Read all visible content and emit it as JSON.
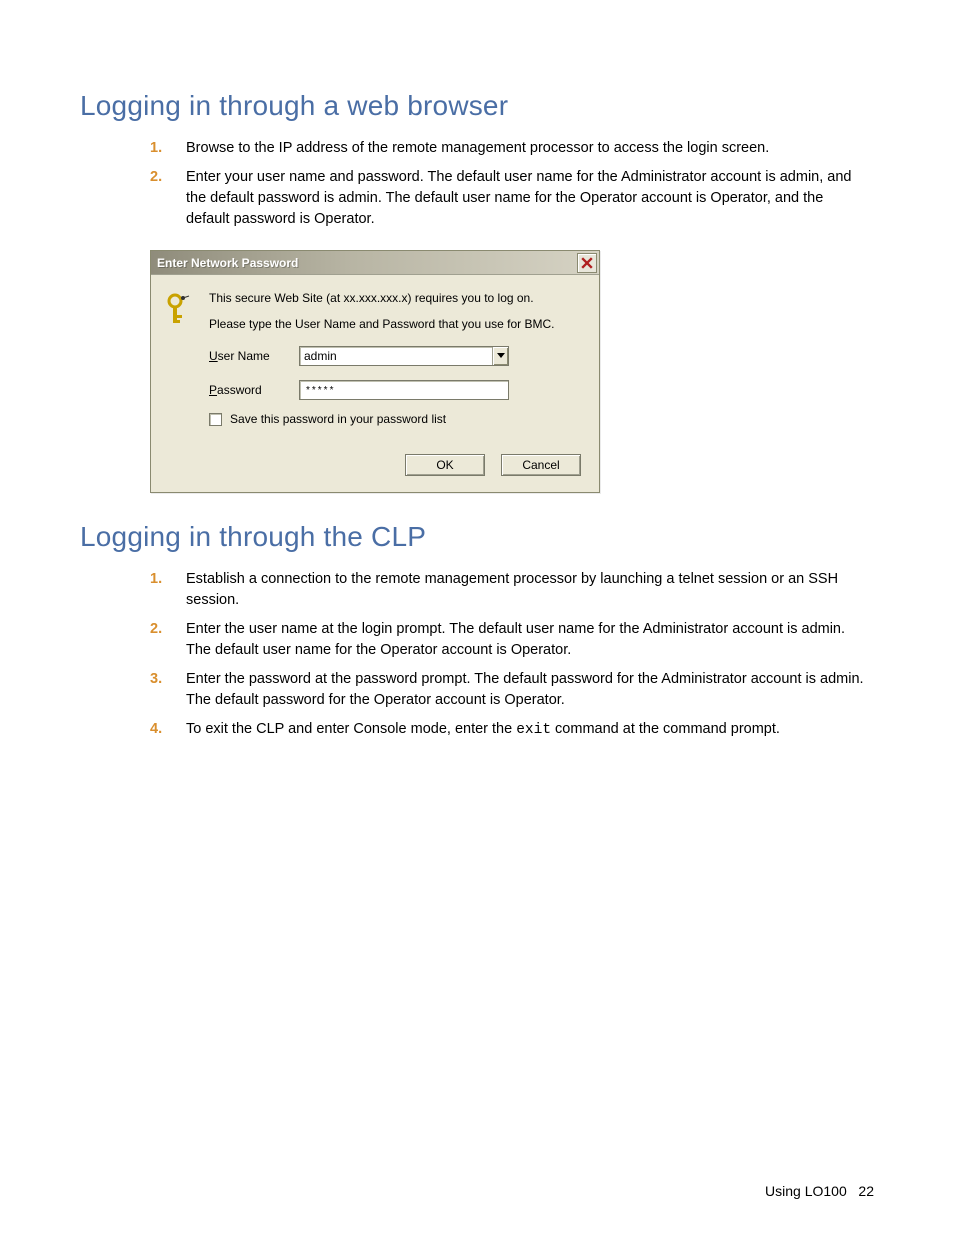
{
  "section1": {
    "heading": "Logging in through a web browser",
    "steps": [
      "Browse to the IP address of the remote management processor to access the login screen.",
      "Enter your user name and password. The default user name for the Administrator account is admin, and the default password is admin. The default user name for the Operator account is Operator, and the default password is Operator."
    ]
  },
  "dialog": {
    "title": "Enter Network Password",
    "line1": "This secure Web Site (at xx.xxx.xxx.x) requires you to log on.",
    "line2": "Please type the User Name and Password that you use for BMC.",
    "username_label_pre": "U",
    "username_label_post": "ser Name",
    "username_value": "admin",
    "password_label_pre": "P",
    "password_label_post": "assword",
    "password_value": "*****",
    "save_label_pre": "S",
    "save_label_post": "ave this password in your password list",
    "ok": "OK",
    "cancel": "Cancel"
  },
  "section2": {
    "heading": "Logging in through the CLP",
    "steps": [
      "Establish a connection to the remote management processor by launching a telnet session or an SSH session.",
      "Enter the user name at the login prompt. The default user name for the Administrator account is admin. The default user name for the Operator account is Operator.",
      "Enter the password at the password prompt. The default password for the Administrator account is admin. The default password for the Operator account is Operator."
    ],
    "step4_pre": "To exit the CLP and enter Console mode, enter the ",
    "step4_code": "exit",
    "step4_post": " command at the command prompt."
  },
  "footer": {
    "label": "Using LO100",
    "page": "22"
  },
  "numbers": {
    "n1": "1.",
    "n2": "2.",
    "n3": "3.",
    "n4": "4."
  }
}
